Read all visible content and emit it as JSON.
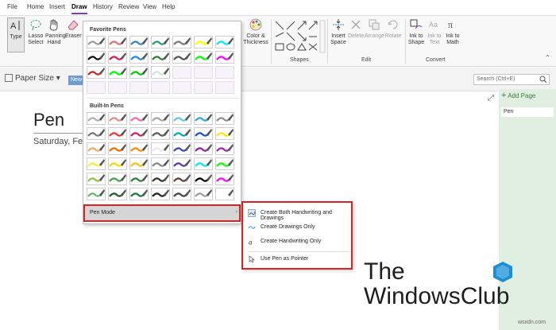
{
  "tabs": [
    "File",
    "Home",
    "Insert",
    "Draw",
    "History",
    "Review",
    "View",
    "Help"
  ],
  "active_tab": "Draw",
  "ribbon": {
    "tools": {
      "type": "Type",
      "lasso": "Lasso\nSelect",
      "panning": "Panning\nHand",
      "eraser": "Eraser"
    },
    "color_thickness": "Color &\nThickness",
    "shapes_label": "Shapes",
    "edit": {
      "insert_space": "Insert\nSpace",
      "delete": "Delete",
      "arrange": "Arrange",
      "rotate": "Rotate",
      "label": "Edit"
    },
    "convert": {
      "ink_to_shape": "Ink to\nShape",
      "ink_to_text": "Ink to\nText",
      "ink_to_math": "Ink to\nMath",
      "label": "Convert"
    }
  },
  "toolbar": {
    "paper_size": "Paper Size",
    "paper_size_arrow": "▾",
    "new_button": "New",
    "search_placeholder": "Search (Ctrl+E)"
  },
  "page": {
    "title": "Pen",
    "date": "Saturday, Feb"
  },
  "right_panel": {
    "add_page": "Add Page",
    "page_entry": "Pen"
  },
  "pen_menu": {
    "favorite_header": "Favorite Pens",
    "builtin_header": "Built-In Pens",
    "pen_mode_label": "Pen Mode",
    "pen_mode_arrow": "›",
    "favorite_rows": [
      [
        "#9aa0a6",
        "#e07070",
        "#3a7fc4",
        "#2a9d6a",
        "#7a7a7a",
        "#ffff00",
        "#00e5ff"
      ],
      [
        "#111111",
        "#d81b60",
        "#1e88e5",
        "#2e7d32",
        "#555555",
        "#00ff00",
        "#ff00ff"
      ],
      [
        "#c62828",
        "#00ff00",
        "#00cc00",
        "#cfeacc",
        "",
        "",
        ""
      ],
      [
        "",
        "",
        "",
        "",
        "",
        "",
        ""
      ]
    ],
    "builtin_rows": [
      [
        "#b0b0b0",
        "#e88a8a",
        "#f06aa8",
        "#a6a6a6",
        "#5bc8e8",
        "#2da8e0",
        "#8f8f8f"
      ],
      [
        "#777777",
        "#e53935",
        "#d81b60",
        "#5b5b5b",
        "#00acc1",
        "#1e4fd8",
        "#ffe600"
      ],
      [
        "#f2a86a",
        "#ef6c00",
        "#fb8c00",
        "#e8e8e8",
        "#3949ab",
        "#8e24aa",
        "#9c27b0"
      ],
      [
        "#ffeb3b",
        "#ffd600",
        "#ffc107",
        "#888888",
        "#5e35b1",
        "#00e5ff",
        "#00ff00"
      ],
      [
        "#8bc34a",
        "#43a047",
        "#2e7d32",
        "#333333",
        "#5d4037",
        "#000000",
        "#ff00ff"
      ],
      [
        "#66bb6a",
        "#1b5e20",
        "#1b7a3a",
        "#222222",
        "#444444",
        "#9e9e9e",
        "#ffffff"
      ]
    ]
  },
  "pen_mode_menu": {
    "items": [
      "Create Both Handwriting and Drawings",
      "Create Drawings Only",
      "Create Handwriting Only",
      "Use Pen as Pointer"
    ]
  },
  "watermark": {
    "line1": "The",
    "line2": "WindowsClub",
    "site": "wsxdn.com"
  },
  "colors": {
    "accent": "#7b3fa8",
    "highlight_border": "#dd2222",
    "panel_green": "#e1efe1",
    "logo_blue": "#1a8fd6"
  }
}
